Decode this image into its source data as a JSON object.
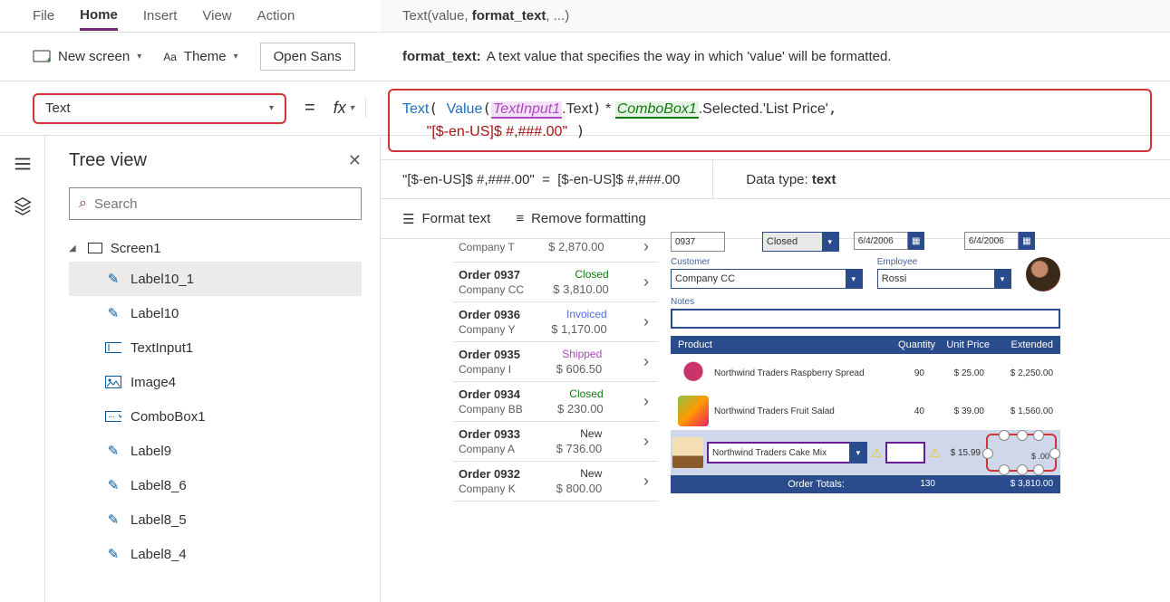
{
  "menubar": {
    "file": "File",
    "home": "Home",
    "insert": "Insert",
    "view": "View",
    "action": "Action"
  },
  "ribbon": {
    "newScreen": "New screen",
    "theme": "Theme",
    "fontSelect": "Open Sans"
  },
  "property": {
    "selected": "Text"
  },
  "signature": {
    "fn": "Text",
    "args": "(value, ",
    "bold": "format_text",
    "rest": ", ...)"
  },
  "description": {
    "label": "format_text:",
    "text": "A text value that specifies the way in which 'value' will be formatted."
  },
  "formula": {
    "fn": "Text",
    "valueFn": "Value",
    "ref1": "TextInput1",
    "prop1": ".Text",
    "op": " * ",
    "ref2": "ComboBox1",
    "prop2": ".Selected.'List Price'",
    "line2Indent": "      ",
    "str": "\"[$-en-US]$ #,###.00\""
  },
  "eval": {
    "left": "\"[$-en-US]$ #,###.00\"",
    "eq": "=",
    "right": "[$-en-US]$ #,###.00",
    "dtLabel": "Data type:",
    "dtValue": "text"
  },
  "fmt": {
    "format": "Format text",
    "remove": "Remove formatting"
  },
  "tree": {
    "title": "Tree view",
    "searchPlaceholder": "Search",
    "screen": "Screen1",
    "items": [
      {
        "label": "Label10_1",
        "icon": "pen"
      },
      {
        "label": "Label10",
        "icon": "pen"
      },
      {
        "label": "TextInput1",
        "icon": "input"
      },
      {
        "label": "Image4",
        "icon": "image"
      },
      {
        "label": "ComboBox1",
        "icon": "combo"
      },
      {
        "label": "Label9",
        "icon": "pen"
      },
      {
        "label": "Label8_6",
        "icon": "pen"
      },
      {
        "label": "Label8_5",
        "icon": "pen"
      },
      {
        "label": "Label8_4",
        "icon": "pen"
      }
    ]
  },
  "orders": [
    {
      "title": "",
      "sub": "Company T",
      "status": "",
      "statusClass": "",
      "price": "$ 2,870.00"
    },
    {
      "title": "Order 0937",
      "sub": "Company CC",
      "status": "Closed",
      "statusClass": "st-closed",
      "price": "$ 3,810.00"
    },
    {
      "title": "Order 0936",
      "sub": "Company Y",
      "status": "Invoiced",
      "statusClass": "st-invoiced",
      "price": "$ 1,170.00"
    },
    {
      "title": "Order 0935",
      "sub": "Company I",
      "status": "Shipped",
      "statusClass": "st-shipped",
      "price": "$ 606.50"
    },
    {
      "title": "Order 0934",
      "sub": "Company BB",
      "status": "Closed",
      "statusClass": "st-closed",
      "price": "$ 230.00"
    },
    {
      "title": "Order 0933",
      "sub": "Company A",
      "status": "New",
      "statusClass": "st-new",
      "price": "$ 736.00"
    },
    {
      "title": "Order 0932",
      "sub": "Company K",
      "status": "New",
      "statusClass": "st-new",
      "price": "$ 800.00"
    }
  ],
  "form": {
    "orderNo": "0937",
    "status": "Closed",
    "date1": "6/4/2006",
    "date2": "6/4/2006",
    "customerLabel": "Customer",
    "employeeLabel": "Employee",
    "customer": "Company CC",
    "employee": "Rossi",
    "notesLabel": "Notes"
  },
  "ptable": {
    "headers": {
      "product": "Product",
      "qty": "Quantity",
      "unit": "Unit Price",
      "ext": "Extended"
    },
    "rows": [
      {
        "name": "Northwind Traders Raspberry Spread",
        "qty": "90",
        "unit": "$ 25.00",
        "ext": "$ 2,250.00",
        "img": "a"
      },
      {
        "name": "Northwind Traders Fruit Salad",
        "qty": "40",
        "unit": "$ 39.00",
        "ext": "$ 1,560.00",
        "img": "b"
      }
    ],
    "newRow": {
      "name": "Northwind Traders Cake Mix",
      "unit": "$ 15.99",
      "ext": "$ .00"
    },
    "totals": {
      "label": "Order Totals:",
      "qty": "130",
      "ext": "$ 3,810.00"
    }
  }
}
